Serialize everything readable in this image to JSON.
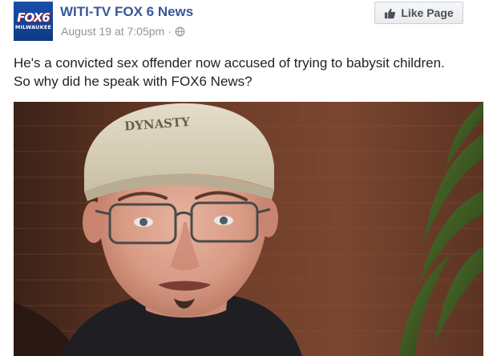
{
  "page": {
    "name": "WITI-TV FOX 6 News",
    "logo": {
      "line1": "FOX6",
      "line2": "MILWAUKEE"
    },
    "like_button": "Like Page"
  },
  "post": {
    "timestamp": "August 19 at 7:05pm",
    "separator": "·",
    "privacy_icon": "globe-icon",
    "text_line1": "He's a convicted sex offender now accused of trying to babysit children.",
    "text_line2": "So why did he speak with FOX6 News?",
    "image": {
      "description_icon": "photo",
      "cap_text": "DYNASTY"
    }
  },
  "colors": {
    "link": "#365899",
    "meta": "#90949c",
    "text": "#1d2129",
    "logo_blue": "#0c3a87"
  }
}
